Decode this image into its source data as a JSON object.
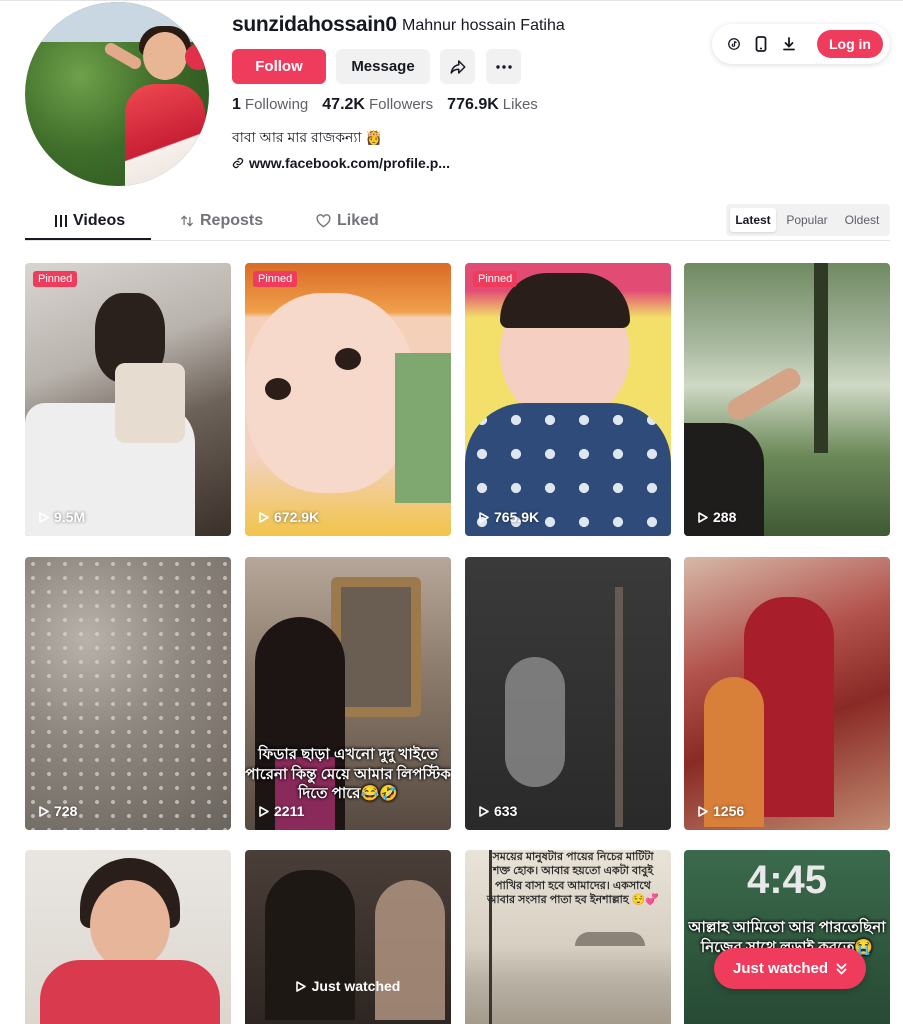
{
  "profile": {
    "username": "sunzidahossain0",
    "nickname": "Mahnur hossain Fatiha",
    "follow_label": "Follow",
    "message_label": "Message",
    "stats": [
      {
        "value": "1",
        "label": "Following"
      },
      {
        "value": "47.2K",
        "label": "Followers"
      },
      {
        "value": "776.9K",
        "label": "Likes"
      }
    ],
    "bio": "বাবা আর মার রাজকন্যা 👸",
    "link": "www.facebook.com/profile.p..."
  },
  "header": {
    "login_label": "Log in",
    "tool_icons": [
      "tiktok-coin-icon",
      "mobile-icon",
      "download-icon"
    ]
  },
  "tabs": [
    {
      "label": "Videos",
      "icon": "grid-icon",
      "active": true
    },
    {
      "label": "Reposts",
      "icon": "repost-icon",
      "active": false
    },
    {
      "label": "Liked",
      "icon": "heart-icon",
      "active": false
    }
  ],
  "sort": [
    {
      "label": "Latest",
      "active": true
    },
    {
      "label": "Popular",
      "active": false
    },
    {
      "label": "Oldest",
      "active": false
    }
  ],
  "videos": [
    {
      "pinned_label": "Pinned",
      "views": "9.5M"
    },
    {
      "pinned_label": "Pinned",
      "views": "672.9K"
    },
    {
      "pinned_label": "Pinned",
      "views": "765.9K"
    },
    {
      "views": "288"
    },
    {
      "views": "728"
    },
    {
      "views": "2211",
      "caption": "ফিডার ছাড়া এখনো দুদু খাইতে পারেনা কিন্তু মেয়ে আমার লিপস্টিক দিতে পারে😂🤣"
    },
    {
      "views": "633"
    },
    {
      "views": "1256"
    },
    {
      "views": ""
    },
    {
      "just_watched": "Just watched"
    },
    {
      "caption": "সময়ের মানুষটার পায়ের নিচের মাটিটা শক্ত হোক। আবার হয়তো একটা বাবুই পাখির বাসা হবে আমাদের। একসাথে আবার সংসার পাতা হব ইনশাল্লাহ 😌💞"
    },
    {
      "overlay_time": "4:45",
      "caption": "আল্লাহ আমিতো আর পারতেছিনা নিজের সাথে লড়াই করতে😭"
    }
  ],
  "just_watched_button": "Just watched",
  "colors": {
    "accent": "#ef3c5d",
    "text": "#161823",
    "muted": "#73747b"
  }
}
